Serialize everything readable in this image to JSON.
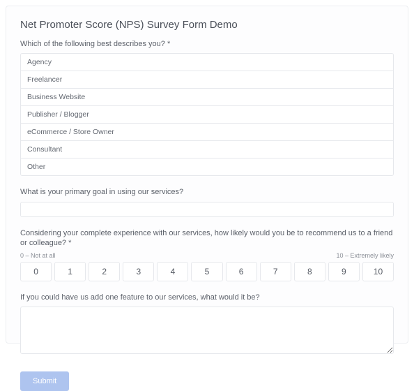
{
  "form": {
    "title": "Net Promoter Score (NPS) Survey Form Demo",
    "q1": {
      "label": "Which of the following best describes you? *",
      "options": [
        "Agency",
        "Freelancer",
        "Business Website",
        "Publisher / Blogger",
        "eCommerce / Store Owner",
        "Consultant",
        "Other"
      ]
    },
    "q2": {
      "label": "What is your primary goal in using our services?"
    },
    "q3": {
      "label": "Considering your complete experience with our services, how likely would you be to recommend us to a friend or colleague? *",
      "left_hint": "0 – Not at all",
      "right_hint": "10 – Extremely likely",
      "scale": [
        "0",
        "1",
        "2",
        "3",
        "4",
        "5",
        "6",
        "7",
        "8",
        "9",
        "10"
      ]
    },
    "q4": {
      "label": "If you could have us add one feature to our services, what would it be?"
    },
    "submit_label": "Submit"
  }
}
